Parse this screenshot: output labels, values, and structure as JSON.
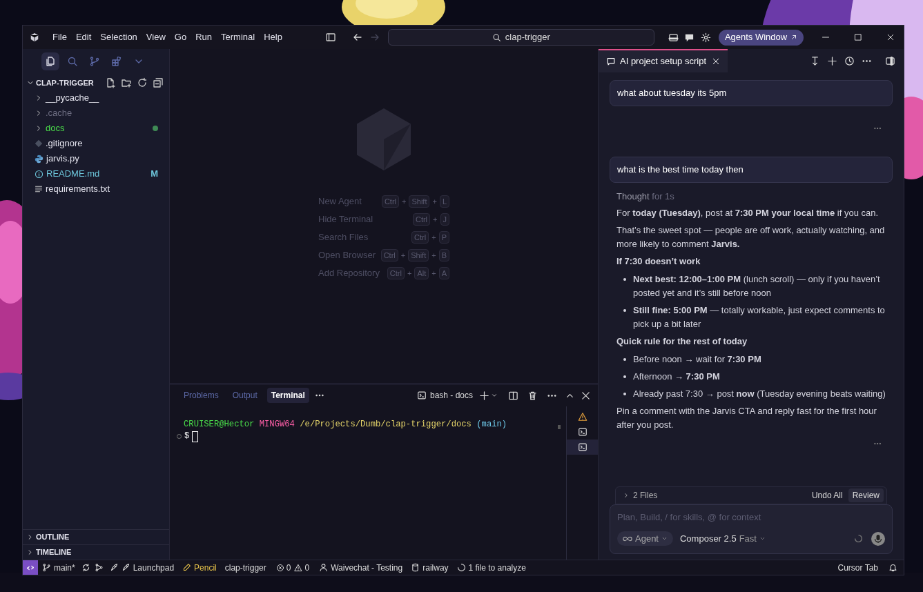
{
  "menu": [
    "File",
    "Edit",
    "Selection",
    "View",
    "Go",
    "Run",
    "Terminal",
    "Help"
  ],
  "search": {
    "value": "clap-trigger"
  },
  "agents_button": "Agents Window",
  "activity_tabs": [
    {
      "kind": "files",
      "selected": true
    },
    {
      "kind": "search",
      "selected": false
    },
    {
      "kind": "branch",
      "selected": false
    },
    {
      "kind": "extensions",
      "selected": false
    },
    {
      "kind": "chevron",
      "selected": false
    }
  ],
  "explorer": {
    "title": "CLAP-TRIGGER",
    "expanded": true,
    "items": [
      {
        "name": "__pycache__",
        "kind": "folder",
        "color": "#e4e4ee",
        "has_changes": false
      },
      {
        "name": ".cache",
        "kind": "folder",
        "color": "#6c6c80",
        "has_changes": false
      },
      {
        "name": "docs",
        "kind": "folder",
        "color": "#4ade4a",
        "has_changes": true
      },
      {
        "name": ".gitignore",
        "kind": "git",
        "color": "#e4e4ee",
        "has_changes": false
      },
      {
        "name": "jarvis.py",
        "kind": "python",
        "color": "#e4e4ee",
        "has_changes": false
      },
      {
        "name": "README.md",
        "kind": "info",
        "color": "#6ec8dd",
        "has_changes": false,
        "badge": "M"
      },
      {
        "name": "requirements.txt",
        "kind": "text",
        "color": "#e4e4ee",
        "has_changes": false
      }
    ]
  },
  "sections": [
    {
      "label": "OUTLINE",
      "expanded": false
    },
    {
      "label": "TIMELINE",
      "expanded": false
    }
  ],
  "shortcuts": [
    {
      "label": "New Agent",
      "keys": [
        "Ctrl",
        "+",
        "Shift",
        "+",
        "L"
      ]
    },
    {
      "label": "Hide Terminal",
      "keys": [
        "Ctrl",
        "+",
        "J"
      ]
    },
    {
      "label": "Search Files",
      "keys": [
        "Ctrl",
        "+",
        "P"
      ]
    },
    {
      "label": "Open Browser",
      "keys": [
        "Ctrl",
        "+",
        "Shift",
        "+",
        "B"
      ]
    },
    {
      "label": "Add Repository",
      "keys": [
        "Ctrl",
        "+",
        "Alt",
        "+",
        "A"
      ]
    }
  ],
  "panel": {
    "tabs": [
      {
        "label": "Problems",
        "selected": false
      },
      {
        "label": "Output",
        "selected": false
      },
      {
        "label": "Terminal",
        "selected": true
      }
    ],
    "terminal_name": "bash - docs",
    "prompt": {
      "user": "CRUISER@Hector",
      "system": "MINGW64",
      "path": "/e/Projects/Dumb/clap-trigger/docs",
      "branch": "(main)",
      "symbol": "$"
    },
    "terminals": [
      {
        "kind": "warning",
        "selected": false
      },
      {
        "kind": "shell",
        "selected": false
      },
      {
        "kind": "shell",
        "selected": true
      }
    ]
  },
  "chat": {
    "tab": "AI project setup script",
    "messages": [
      {
        "kind": "user",
        "text": "what about tuesday its 5pm"
      },
      {
        "kind": "actions"
      },
      {
        "kind": "user",
        "text": "what is the best time today then"
      },
      {
        "kind": "assistant",
        "thought": "Thought",
        "thought_time": "for 1s",
        "blocks": [
          {
            "kind": "p",
            "text": "For **today (Tuesday)**, post at **7:30 PM your local time** if you can."
          },
          {
            "kind": "p",
            "text": "That’s the sweet spot — people are off work, actually watching, and more likely to comment **Jarvis.**"
          },
          {
            "kind": "heading",
            "text": "If 7:30 doesn’t work"
          },
          {
            "kind": "bullet",
            "text": "**Next best: 12:00–1:00 PM** (lunch scroll) — only if you haven’t posted yet and it’s still before noon"
          },
          {
            "kind": "bullet",
            "text": "**Still fine: 5:00 PM** — totally workable, just expect comments to pick up a bit later"
          },
          {
            "kind": "heading",
            "text": "Quick rule for the rest of today"
          },
          {
            "kind": "bullet",
            "text": "Before noon → wait for **7:30 PM**"
          },
          {
            "kind": "bullet",
            "text": "Afternoon → **7:30 PM**"
          },
          {
            "kind": "bullet",
            "text": "Already past 7:30 → post **now** (Tuesday evening beats waiting)"
          },
          {
            "kind": "p",
            "text": "Pin a comment with the Jarvis CTA and reply fast for the first hour after you post."
          }
        ]
      }
    ],
    "changes": {
      "label": "2 Files",
      "expanded": false,
      "undo": "Undo All",
      "review": "Review"
    },
    "composer": {
      "placeholder": "Plan, Build, / for skills, @ for context",
      "mode": "Agent",
      "model": "Composer 2.5",
      "speed": "Fast"
    }
  },
  "status_bar": {
    "left": [
      {
        "kind": "remote"
      },
      {
        "kind": "branch",
        "text": "main*"
      },
      {
        "kind": "sync"
      },
      {
        "kind": "graph"
      },
      {
        "kind": "launchpad",
        "text": "Launchpad"
      },
      {
        "kind": "pencil",
        "text": "Pencil"
      },
      {
        "kind": "plain",
        "text": "clap-trigger"
      },
      {
        "kind": "problems",
        "errors": "0",
        "warnings": "0"
      },
      {
        "kind": "user",
        "text": "Waivechat - Testing"
      },
      {
        "kind": "database",
        "text": "railway"
      },
      {
        "kind": "loading",
        "text": "1 file to analyze"
      }
    ],
    "right": [
      {
        "kind": "plain",
        "text": "Cursor Tab"
      },
      {
        "kind": "bell"
      }
    ]
  }
}
